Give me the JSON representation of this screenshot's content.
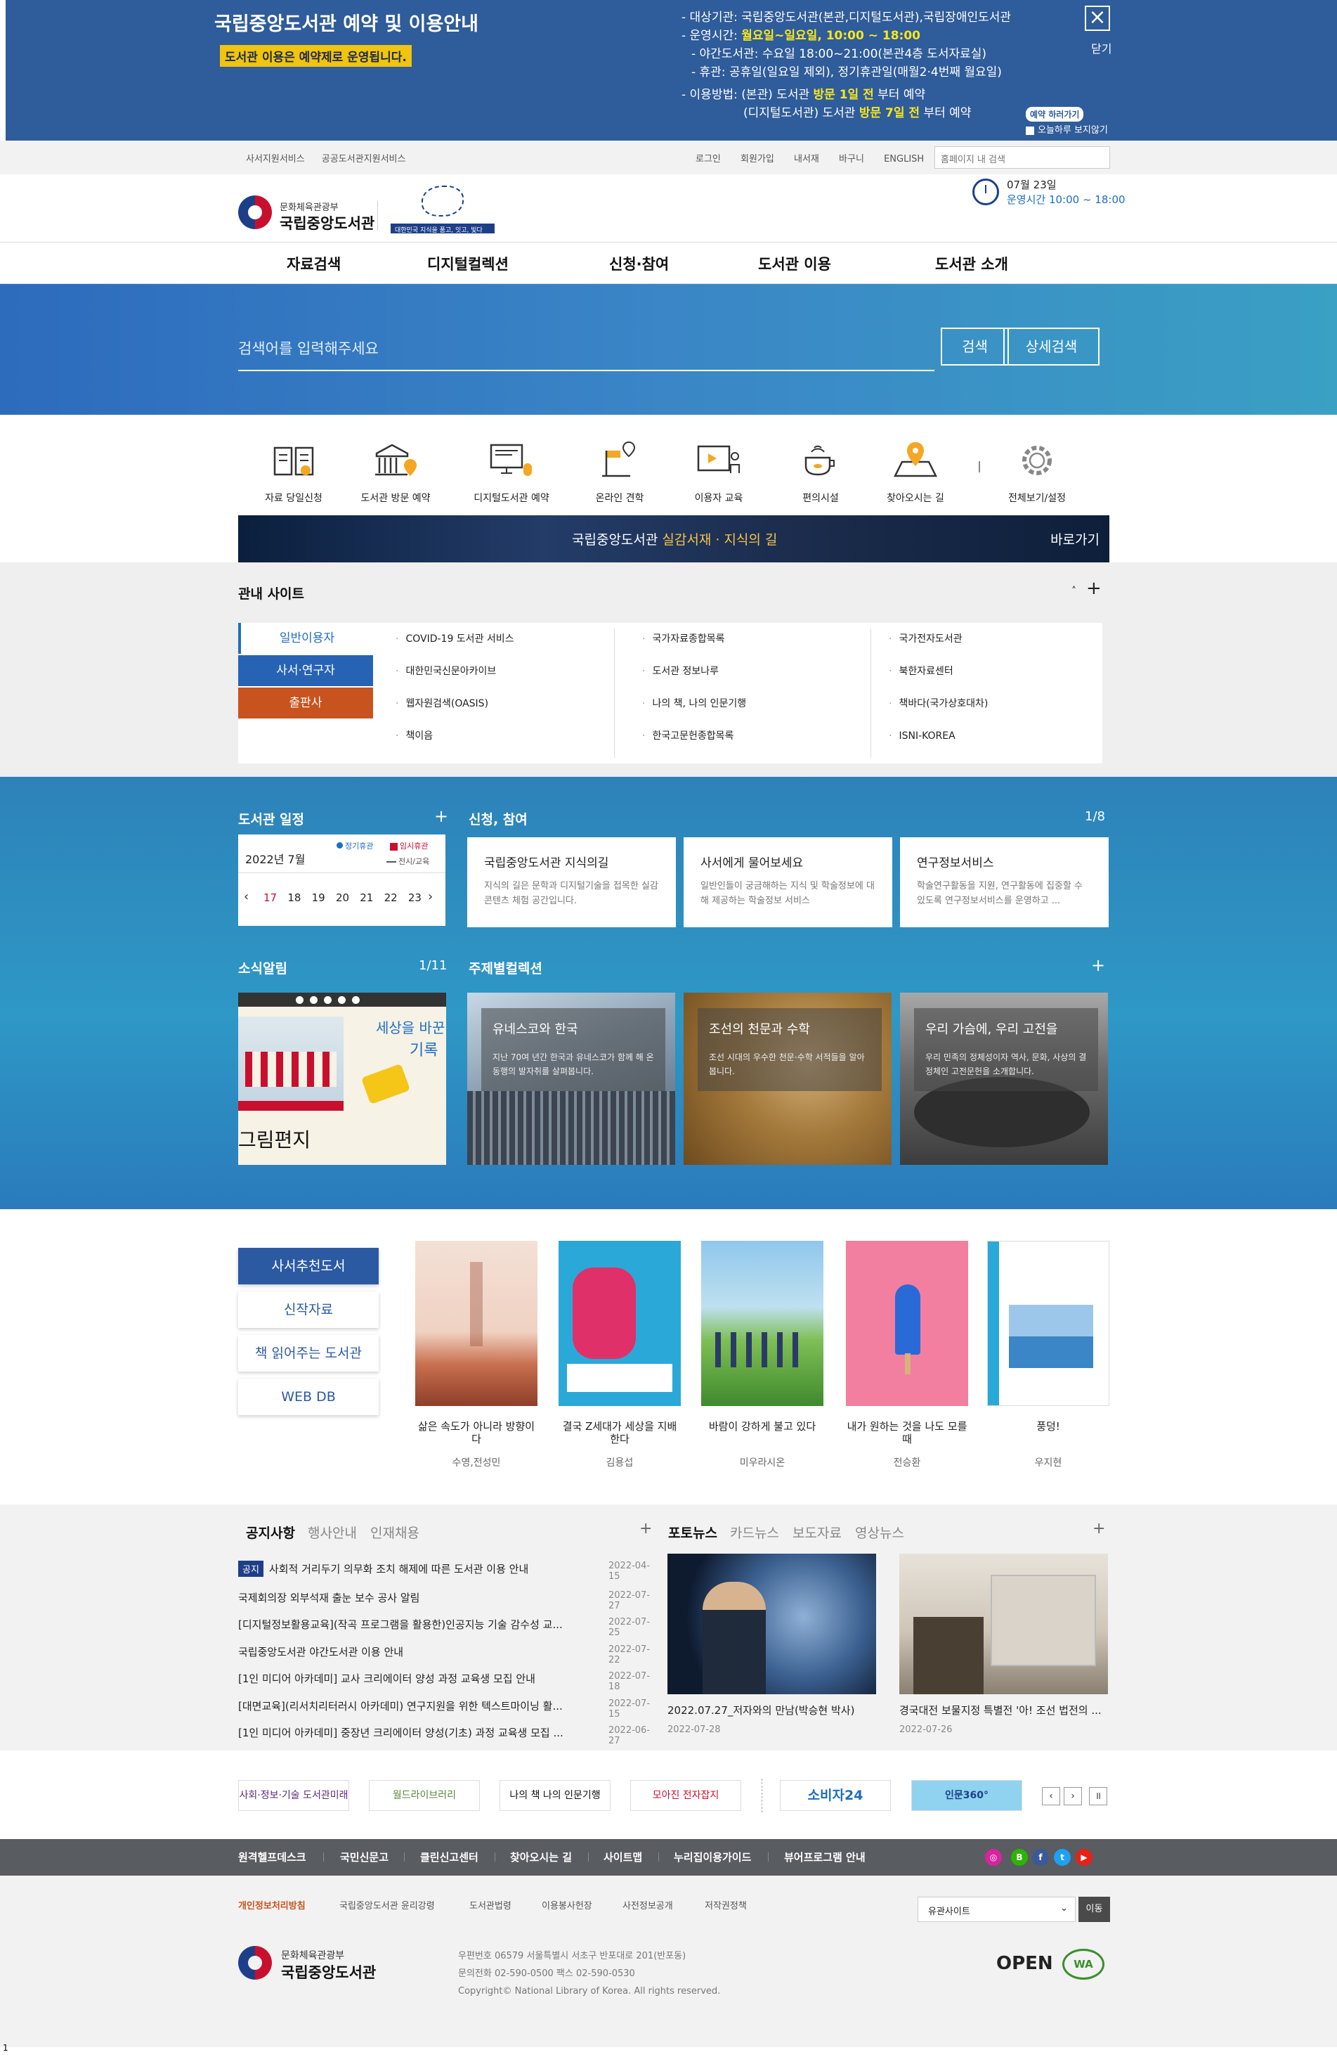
{
  "notice": {
    "title": "국립중앙도서관 예약 및 이용안내",
    "subtitle": "도서관 이용은 예약제로 운영됩니다.",
    "l1": "- 대상기관: 국립중앙도서관(본관,디지털도서관),국립장애인도서관",
    "l2_a": "- 운영시간: ",
    "l2_b": "월요일~일요일, 10:00 ~ 18:00",
    "l3": "- 야간도서관: 수요일 18:00~21:00(본관4층 도서자료실)",
    "l4": "- 휴관: 공휴일(일요일 제외), 정기휴관일(매월2·4번째 월요일)",
    "l5_a": "- 이용방법: (본관) 도서관 ",
    "l5_b": "방문 1일 전",
    "l5_c": " 부터 예약",
    "l6_a": "(디지털도서관) 도서관 ",
    "l6_b": "방문 7일 전",
    "l6_c": " 부터 예약",
    "close_icon": "×",
    "close_label": "닫기",
    "reserve_button": "예약 하러가기",
    "today_hide": "오늘하루 보지않기"
  },
  "util": {
    "left": [
      "사서지원서비스",
      "공공도서관지원서비스"
    ],
    "right": [
      "로그인",
      "회원가입",
      "내서재",
      "바구니",
      "ENGLISH"
    ],
    "search_placeholder": "홈페이지 내 검색"
  },
  "logo": {
    "ministry": "문화체육관광부",
    "name": "국립중앙도서관",
    "slogan_bar": "대한민국 지식을 품고, 잇고, 빛다"
  },
  "hours": {
    "date": "07월 23일",
    "time": "운영시간 10:00 ~ 18:00"
  },
  "gnb": [
    "자료검색",
    "디지털컬렉션",
    "신청·참여",
    "도서관 이용",
    "도서관 소개"
  ],
  "hero": {
    "search_placeholder": "검색어를 입력해주세요",
    "search_button": "검색",
    "advanced_button": "상세검색"
  },
  "quick": [
    {
      "label": "자료 당일신청",
      "icon": "book-icon"
    },
    {
      "label": "도서관 방문 예약",
      "icon": "building-location-icon"
    },
    {
      "label": "디지털도서관 예약",
      "icon": "monitor-mouse-icon"
    },
    {
      "label": "온라인 견학",
      "icon": "flag-location-icon"
    },
    {
      "label": "이용자 교육",
      "icon": "presentation-icon"
    },
    {
      "label": "편의시설",
      "icon": "coffee-cup-icon"
    },
    {
      "label": "찾아오시는 길",
      "icon": "map-pin-icon"
    },
    {
      "label": "전체보기/설정",
      "icon": "gear-icon"
    }
  ],
  "banner": {
    "text_a": "국립중앙도서관 ",
    "text_b": "실감서재 · 지식의 길",
    "go": "바로가기"
  },
  "related": {
    "title": "관내 사이트",
    "tabs": [
      "일반이용자",
      "사서·연구자",
      "출판사"
    ],
    "col1": [
      "COVID-19 도서관 서비스",
      "대한민국신문아카이브",
      "웹자원검색(OASIS)",
      "책이음"
    ],
    "col2": [
      "국가자료종합목록",
      "도서관 정보나루",
      "나의 책, 나의 인문기행",
      "한국고문헌종합목록"
    ],
    "col3": [
      "국가전자도서관",
      "북한자료센터",
      "책바다(국가상호대차)",
      "ISNI-KOREA"
    ],
    "up_icon": "˄",
    "plus_icon": "+"
  },
  "schedule": {
    "title": "도서관 일정",
    "plus": "+",
    "legend": [
      "정기휴관",
      "임시휴관",
      "전시/교육"
    ],
    "month": "2022년 7월",
    "days": [
      "17",
      "18",
      "19",
      "20",
      "21",
      "22",
      "23"
    ],
    "prev": "‹",
    "next": "›"
  },
  "apply": {
    "title": "신청, 참여",
    "pager": "1/8",
    "cards": [
      {
        "title": "국립중앙도서관 지식의길",
        "desc": "지식의 길은 문학과 디지털기술을 접목한 실감 콘텐츠 체험 공간입니다."
      },
      {
        "title": "사서에게 물어보세요",
        "desc": "일반인들이 궁금해하는 지식 및 학술정보에 대해 제공하는 학술정보 서비스"
      },
      {
        "title": "연구정보서비스",
        "desc": "학술연구활동을 지원, 연구활동에 집중할 수 있도록 연구정보서비스를 운영하고 ..."
      }
    ]
  },
  "news": {
    "title": "소식알림",
    "pager": "1/11",
    "img_text1": "세상을 바꾼",
    "img_text2": "기록",
    "img_text3": "그림편지"
  },
  "themes": {
    "title": "주제별컬렉션",
    "plus": "+",
    "items": [
      {
        "title": "유네스코와 한국",
        "desc": "지난 70여 년간 한국과 유네스코가 함께 해 온 동행의 발자취를 살펴봅니다."
      },
      {
        "title": "조선의 천문과 수학",
        "desc": "조선 시대의 우수한 천문·수학 서적들을 알아봅니다."
      },
      {
        "title": "우리 가슴에, 우리 고전을",
        "desc": "우리 민족의 정체성이자 역사, 문화, 사상의 결정체인 고전문헌을 소개합니다."
      }
    ]
  },
  "books": {
    "tabs": [
      "사서추천도서",
      "신작자료",
      "책 읽어주는 도서관",
      "WEB DB"
    ],
    "items": [
      {
        "title": "삶은 속도가 아니라 방향이다",
        "author": "수영,전성민"
      },
      {
        "title": "결국 Z세대가 세상을 지배한다",
        "author": "김용섭"
      },
      {
        "title": "바람이 강하게 불고 있다",
        "author": "미우라시온"
      },
      {
        "title": "내가 원하는 것을 나도 모를 때",
        "author": "전승환"
      },
      {
        "title": "풍덩!",
        "author": "우지현"
      }
    ]
  },
  "board": {
    "tabs": [
      "공지사항",
      "행사안내",
      "인재채용"
    ],
    "badge": "공지",
    "notices": [
      {
        "title": "사회적 거리두기 의무화 조치 해제에 따른 도서관 이용 안내",
        "date": "2022-04-15"
      },
      {
        "title": "국제회의장 외부석재 출눈 보수 공사 알림",
        "date": "2022-07-27"
      },
      {
        "title": "[디지털정보활용교육](작곡 프로그램을 활용한)인공지능 기술 감수성 교...",
        "date": "2022-07-25"
      },
      {
        "title": "국립중앙도서관 야간도서관 이용 안내",
        "date": "2022-07-22"
      },
      {
        "title": "[1인 미디어 아카데미] 교사 크리에이터 양성 과정 교육생 모집 안내",
        "date": "2022-07-18"
      },
      {
        "title": "[대면교육](리서치리터러시 아카데미) 연구지원을 위한 텍스트마이닝 활...",
        "date": "2022-07-15"
      },
      {
        "title": "[1인 미디어 아카데미] 중장년 크리에이터 양성(기초) 과정 교육생 모집 ...",
        "date": "2022-06-27"
      }
    ],
    "photo_tabs": [
      "포토뉴스",
      "카드뉴스",
      "보도자료",
      "영상뉴스"
    ],
    "photos": [
      {
        "caption": "2022.07.27_저자와의 만남(박승현 박사)",
        "date": "2022-07-28"
      },
      {
        "caption": "경국대전 보물지정 특별전 '아! 조선 법전의 ...",
        "date": "2022-07-26"
      }
    ],
    "plus": "+"
  },
  "partners": [
    "사회·정보·기술 도서관미래공방",
    "월드라이브러리",
    "나의 책 나의 인문기행",
    "모아진 전자잡지",
    "소비자24",
    "인문360°"
  ],
  "partner_controls": [
    "‹",
    "›",
    "॥"
  ],
  "footer_nav": [
    "원격헬프데스크",
    "국민신문고",
    "클린신고센터",
    "찾아오시는 길",
    "사이트맵",
    "누리집이용가이드",
    "뷰어프로그램 안내"
  ],
  "sns": [
    "instagram-icon",
    "blog-icon",
    "facebook-icon",
    "twitter-icon",
    "youtube-icon"
  ],
  "footer": {
    "links": [
      "개인정보처리방침",
      "국립중앙도서관 윤리강령",
      "도서관법령",
      "이용봉사헌장",
      "사전정보공개",
      "저작권정책"
    ],
    "family_site": "유관사이트",
    "go": "이동",
    "address": "우편번호 06579 서울특별시 서초구 반포대로 201(반포동)",
    "phone": "문의전화 02-590-0500 팩스 02-590-0530",
    "copyright": "Copyright© National Library of Korea. All rights reserved.",
    "ministry": "문화체육관광부",
    "name": "국립중앙도서관",
    "open": "OPEN",
    "wa": "WA"
  },
  "page_no": "1",
  "colors": {
    "primary": "#1d3f8a",
    "accent_orange": "#c8531e",
    "notice_blue": "#2f5c9a"
  }
}
